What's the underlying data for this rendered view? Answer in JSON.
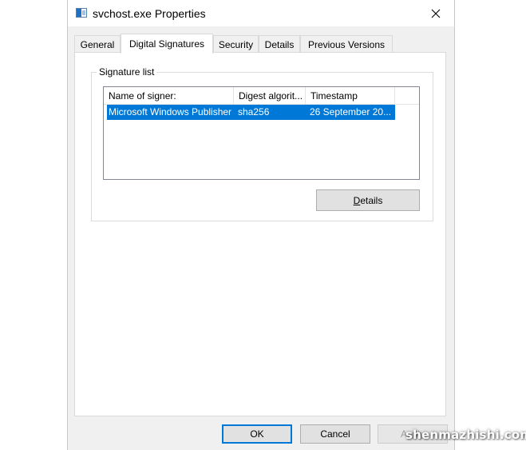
{
  "window": {
    "title": "svchost.exe Properties",
    "icon": "exe-file-icon",
    "close_icon": "close-icon"
  },
  "tabs": [
    {
      "label": "General",
      "active": false
    },
    {
      "label": "Digital Signatures",
      "active": true
    },
    {
      "label": "Security",
      "active": false
    },
    {
      "label": "Details",
      "active": false
    },
    {
      "label": "Previous Versions",
      "active": false
    }
  ],
  "signature_list": {
    "group_label": "Signature list",
    "columns": [
      "Name of signer:",
      "Digest algorit...",
      "Timestamp",
      ""
    ],
    "rows": [
      {
        "signer": "Microsoft Windows Publisher",
        "digest": "sha256",
        "timestamp": "26 September 20...",
        "selected": true
      }
    ],
    "details_button": {
      "mnemonic": "D",
      "rest": "etails"
    }
  },
  "buttons": {
    "ok": "OK",
    "cancel": "Cancel",
    "apply": "Apply"
  },
  "watermark": "shenmazhishi.com",
  "colors": {
    "selection": "#0078d7",
    "dialog_bg": "#f0f0f0",
    "page_bg": "#ffffff"
  }
}
